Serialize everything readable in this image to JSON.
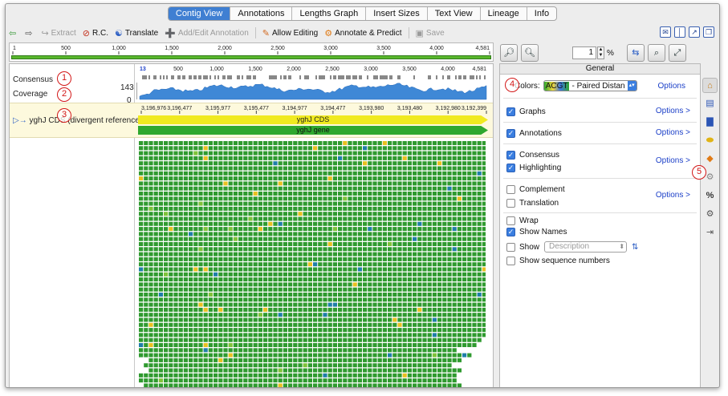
{
  "tabs": [
    "Contig View",
    "Annotations",
    "Lengths Graph",
    "Insert Sizes",
    "Text View",
    "Lineage",
    "Info"
  ],
  "active_tab": "Contig View",
  "toolbar": {
    "extract": "Extract",
    "rc": "R.C.",
    "translate": "Translate",
    "add_edit_annotation": "Add/Edit Annotation",
    "allow_editing": "Allow Editing",
    "annotate_predict": "Annotate & Predict",
    "save": "Save"
  },
  "overview_ticks": [
    "1",
    "500",
    "1,000",
    "1,500",
    "2,000",
    "2,500",
    "3,000",
    "3,500",
    "4,000",
    "4,581"
  ],
  "viewer": {
    "consensus_label": "Consensus",
    "coverage_label": "Coverage",
    "coverage_max": "143",
    "coverage_min": "0",
    "track_ticks": [
      "13",
      "500",
      "1,000",
      "1,500",
      "2,000",
      "2,500",
      "3,000",
      "3,500",
      "4,000",
      "4,581"
    ],
    "reference_label": "yghJ CDS (divergent reference)",
    "ref_ticks": [
      "3,196,976",
      "3,196,477",
      "3,195,977",
      "3,195,477",
      "3,194,977",
      "3,194,477",
      "3,193,980",
      "3,193,480",
      "3,192,980",
      "3,192,399"
    ],
    "cds_label": "yghJ CDS",
    "gene_label": "yghJ gene"
  },
  "callouts": [
    "1",
    "2",
    "3",
    "4",
    "5"
  ],
  "zoom": {
    "value": "1",
    "unit": "%"
  },
  "panel": {
    "header": "General",
    "colors_label": "Colors:",
    "colors_value_prefix": "ACGT",
    "colors_value": "- Paired Distan",
    "options_label": "Options",
    "options_arrow_label": "Options >",
    "graphs": "Graphs",
    "annotations": "Annotations",
    "consensus": "Consensus",
    "highlighting": "Highlighting",
    "complement": "Complement",
    "translation": "Translation",
    "wrap": "Wrap",
    "show_names": "Show Names",
    "show": "Show",
    "description_placeholder": "Description",
    "show_sequence_numbers": "Show sequence numbers"
  },
  "colors": {
    "accent": "#3f7fd2",
    "read_green": "#2f9a2f",
    "coverage_blue": "#3f88d6",
    "cds_yellow": "#f0ea20",
    "gene_green": "#2fa82f",
    "callout_red": "#d21616"
  },
  "side_icons": [
    "home-icon",
    "monitor-icon",
    "bar-chart-icon",
    "ellipse-icon",
    "tag-icon",
    "gear-network-icon",
    "percent-icon",
    "gear-icon",
    "collapse-icon"
  ]
}
